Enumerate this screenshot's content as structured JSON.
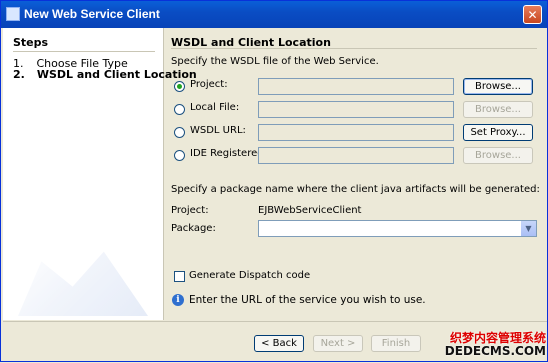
{
  "window": {
    "title": "New Web Service Client"
  },
  "steps": {
    "title": "Steps",
    "items": [
      {
        "number": "1.",
        "label": "Choose File Type"
      },
      {
        "number": "2.",
        "label": "WSDL and Client Location"
      }
    ]
  },
  "section": {
    "title": "WSDL and Client Location",
    "instruction": "Specify the WSDL file of the Web Service."
  },
  "wsdl_options": [
    {
      "label": "Project:",
      "selected": true,
      "button": "Browse..."
    },
    {
      "label": "Local File:",
      "selected": false,
      "button": "Browse..."
    },
    {
      "label": "WSDL URL:",
      "selected": false,
      "button": "Set Proxy..."
    },
    {
      "label": "IDE Registered:",
      "selected": false,
      "button": "Browse..."
    }
  ],
  "package_section": {
    "instruction": "Specify a package name where the client java artifacts will be generated:",
    "project_label": "Project:",
    "project_value": "EJBWebServiceClient",
    "package_label": "Package:",
    "package_value": ""
  },
  "options": {
    "generate_dispatch": "Generate Dispatch code"
  },
  "info": {
    "message": "Enter the URL of the service you wish to use."
  },
  "footer": {
    "back": "< Back",
    "next": "Next >",
    "finish": "Finish",
    "watermark_line1": "织梦内容管理系统",
    "watermark_line2": "DEDECMS.COM"
  }
}
